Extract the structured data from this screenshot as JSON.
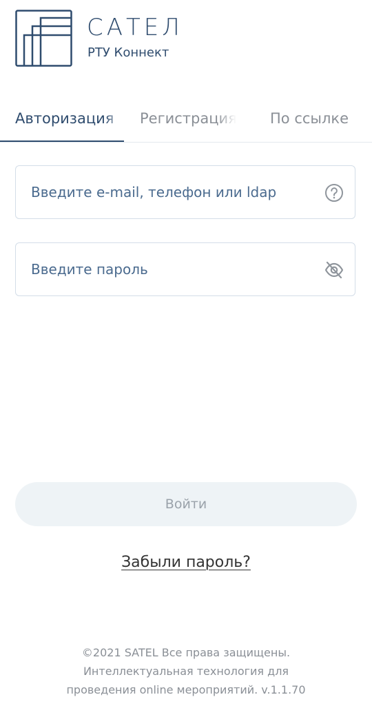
{
  "brand": {
    "name": "САТЕЛ",
    "subtitle": "РТУ Коннект",
    "color": "#2f4c6e"
  },
  "tabs": [
    {
      "label": "Авторизация",
      "active": true
    },
    {
      "label": "Регистрация",
      "active": false
    },
    {
      "label": "По ссылке",
      "active": false
    }
  ],
  "form": {
    "login_placeholder": "Введите e-mail, телефон или ldap",
    "login_icon": "help-circle-icon",
    "password_placeholder": "Введите пароль",
    "password_icon": "eye-off-icon",
    "submit_label": "Войти",
    "forgot_label": "Забыли пароль?"
  },
  "footer": {
    "line1": "©2021 SATEL Все права защищены.",
    "line2": "Интеллектуальная технология для",
    "line3": "проведения online мероприятий. v.1.1.70"
  }
}
